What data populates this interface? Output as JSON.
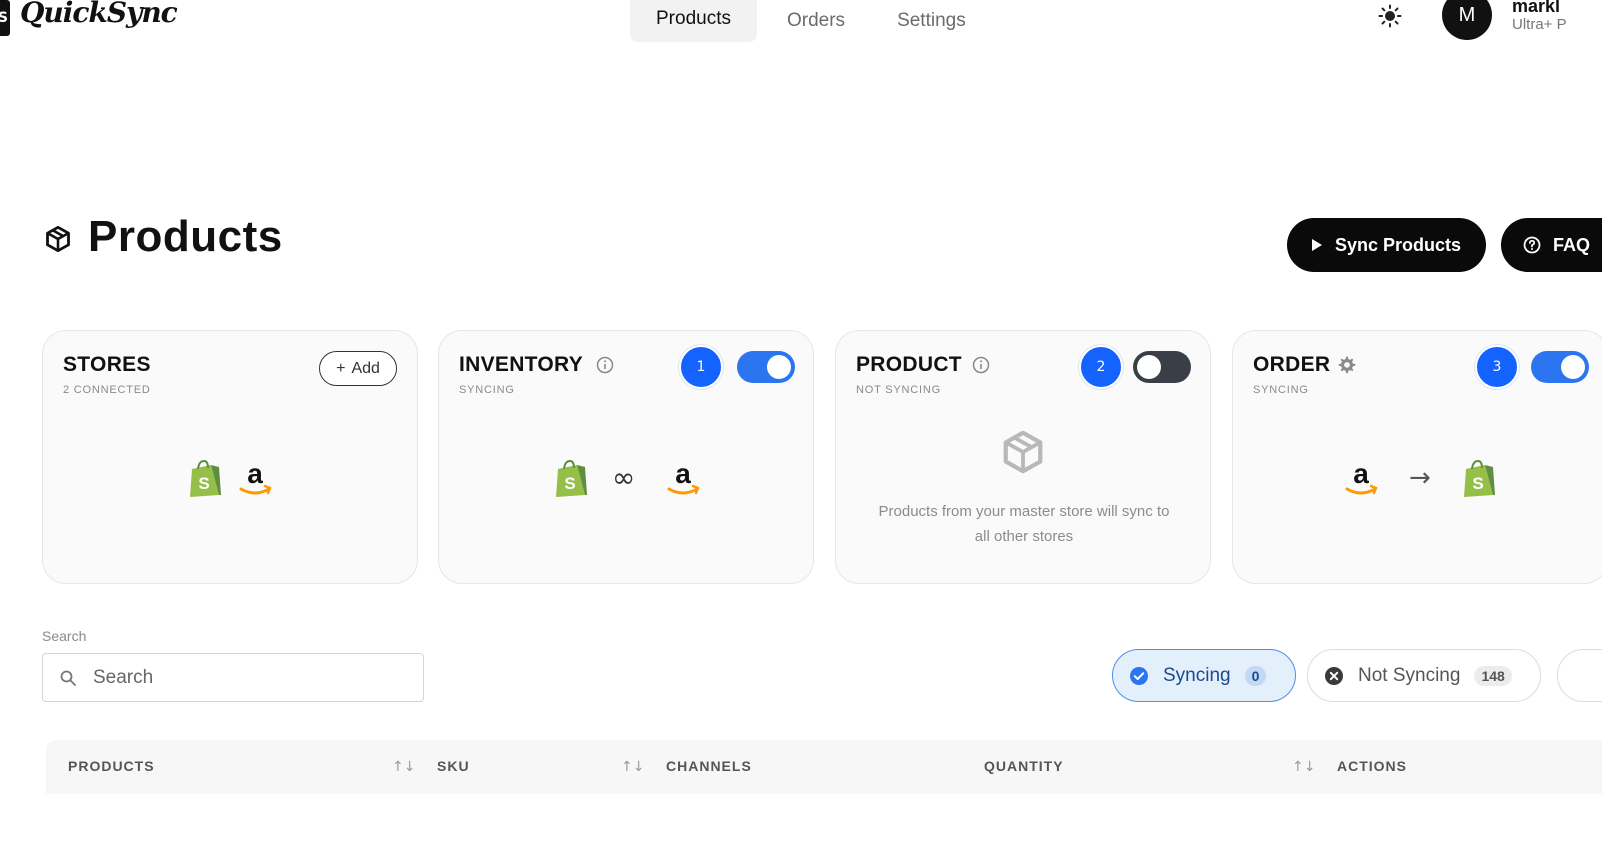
{
  "brand": {
    "logo_letter": "S",
    "name": "QuickSync"
  },
  "nav": {
    "items": [
      {
        "label": "Products",
        "active": true
      },
      {
        "label": "Orders",
        "active": false
      },
      {
        "label": "Settings",
        "active": false
      }
    ]
  },
  "user": {
    "avatar_initial": "M",
    "name": "markl",
    "plan": "Ultra+ P"
  },
  "page": {
    "title": "Products",
    "sync_button": "Sync Products",
    "faq_button": "FAQ"
  },
  "cards": {
    "stores": {
      "title": "STORES",
      "subtitle": "2 CONNECTED",
      "add_label": "Add"
    },
    "inventory": {
      "title": "INVENTORY",
      "subtitle": "SYNCING",
      "step": "1",
      "enabled": true
    },
    "product": {
      "title": "PRODUCT",
      "subtitle": "NOT SYNCING",
      "step": "2",
      "enabled": false,
      "empty_text": "Products from your master store will sync to all other stores"
    },
    "order": {
      "title": "ORDER",
      "subtitle": "SYNCING",
      "step": "3",
      "enabled": true
    }
  },
  "search": {
    "label": "Search",
    "placeholder": "Search",
    "value": ""
  },
  "filters": {
    "syncing": {
      "label": "Syncing",
      "count": "0"
    },
    "not_syncing": {
      "label": "Not Syncing",
      "count": "148"
    }
  },
  "table": {
    "headers": {
      "products": "PRODUCTS",
      "sku": "SKU",
      "channels": "CHANNELS",
      "quantity": "QUANTITY",
      "actions": "ACTIONS"
    }
  },
  "colors": {
    "accent": "#1463ff",
    "toggle_on": "#2b76f0",
    "toggle_off": "#3a3f47",
    "shopify_green": "#95bf47",
    "amazon_orange": "#ff9900"
  }
}
